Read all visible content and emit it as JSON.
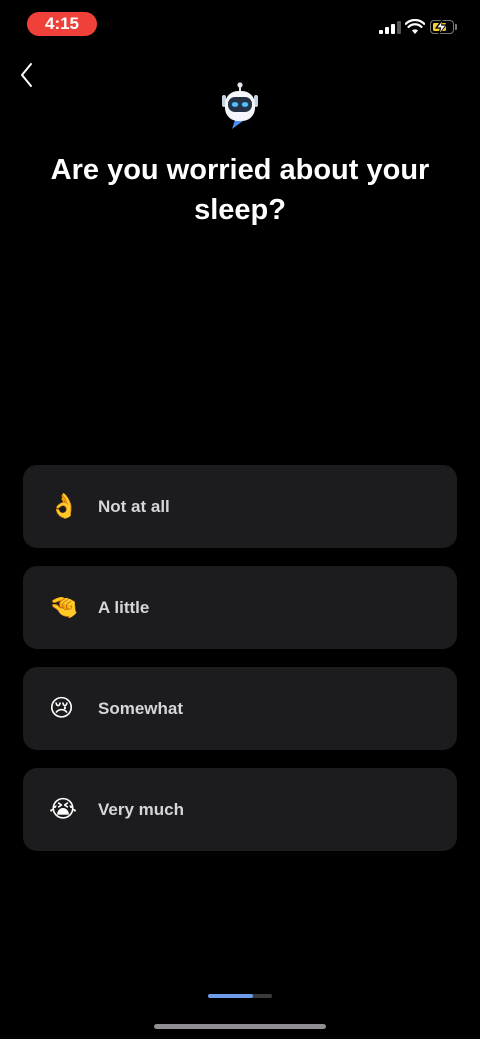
{
  "status_bar": {
    "time": "4:15"
  },
  "question": "Are you worried about your sleep?",
  "options": [
    {
      "emoji": "👌",
      "emoji_name": "ok-hand-icon",
      "label": "Not at all"
    },
    {
      "emoji": "🤏",
      "emoji_name": "pinching-hand-icon",
      "label": "A little"
    },
    {
      "emoji": "😢",
      "emoji_name": "crying-face-icon",
      "label": "Somewhat"
    },
    {
      "emoji": "😭",
      "emoji_name": "loudly-crying-face-icon",
      "label": "Very much"
    }
  ],
  "progress": {
    "fraction": 0.7
  },
  "colors": {
    "background": "#000000",
    "card": "#1c1c1e",
    "time_pill": "#f0403a",
    "progress_fill": "#6f9be8",
    "battery": "#f5d02f"
  }
}
